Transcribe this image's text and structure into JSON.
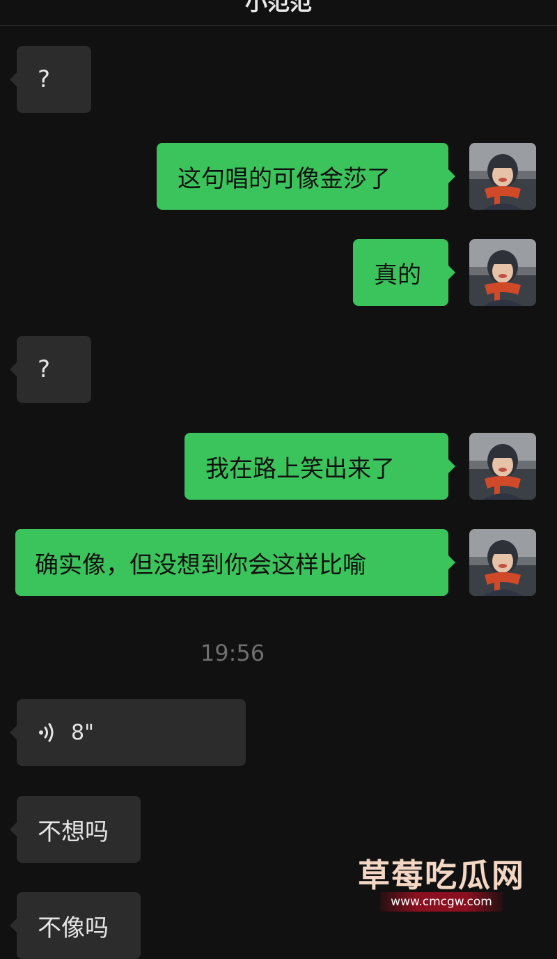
{
  "header": {
    "title": "小范范"
  },
  "messages": [
    {
      "side": "in",
      "text": "?"
    },
    {
      "side": "out",
      "text": "这句唱的可像金莎了"
    },
    {
      "side": "out",
      "text": "真的"
    },
    {
      "side": "in",
      "text": "?"
    },
    {
      "side": "out",
      "text": "我在路上笑出来了"
    },
    {
      "side": "out",
      "text": "确实像，但没想到你会这样比喻"
    },
    {
      "side": "in",
      "type": "voice",
      "duration": "8\""
    },
    {
      "side": "in",
      "text": "不想吗"
    },
    {
      "side": "in",
      "text": "不像吗"
    }
  ],
  "timestamp": "19:56",
  "watermark": {
    "title": "草莓吃瓜网",
    "url": "www.cmcgw.com"
  },
  "colors": {
    "background": "#111111",
    "incoming_bubble": "#2c2c2c",
    "outgoing_bubble": "#3cc45c"
  },
  "icons": {
    "avatar": "avatar-photo",
    "voice": "voice-wave-icon"
  }
}
